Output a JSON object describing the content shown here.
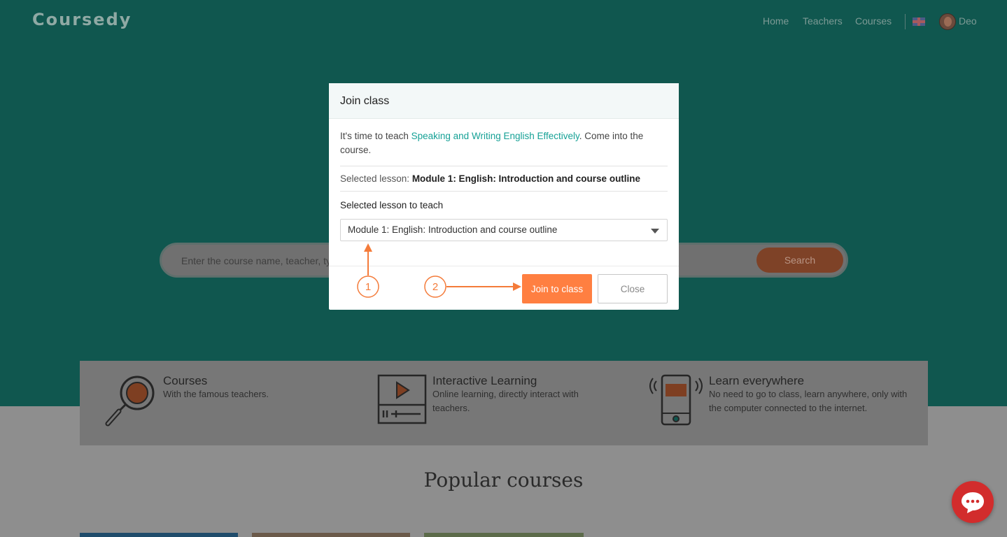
{
  "header": {
    "logo_text": "Coursedy",
    "nav": [
      "Home",
      "Teachers",
      "Courses"
    ],
    "user_name": "Deo"
  },
  "search": {
    "placeholder": "Enter the course name, teacher, type...",
    "button_label": "Search"
  },
  "features": [
    {
      "title": "Courses",
      "desc": "With the famous teachers.",
      "icon": "magnifier-icon"
    },
    {
      "title": "Interactive Learning",
      "desc": "Online learning, directly interact with teachers.",
      "icon": "video-player-icon"
    },
    {
      "title": "Learn everywhere",
      "desc": "No need to go to class, learn anywhere, only with the computer connected to the internet.",
      "icon": "mobile-phone-icon"
    }
  ],
  "popular_title": "Popular courses",
  "modal": {
    "title": "Join class",
    "intro_before": "It's time to teach ",
    "course_name": "Speaking and Writing English Effectively",
    "intro_after": ". Come into the course.",
    "selected_label": "Selected lesson: ",
    "selected_value": "Module 1: English: Introduction and course outline",
    "teach_label": "Selected lesson to teach",
    "select_value": "Module 1: English: Introduction and course outline",
    "join_label": "Join to class",
    "close_label": "Close"
  },
  "annotations": {
    "step1": "1",
    "step2": "2"
  },
  "colors": {
    "accent": "#ff7f41",
    "teal": "#16a196",
    "annotation": "#f47b3a"
  }
}
